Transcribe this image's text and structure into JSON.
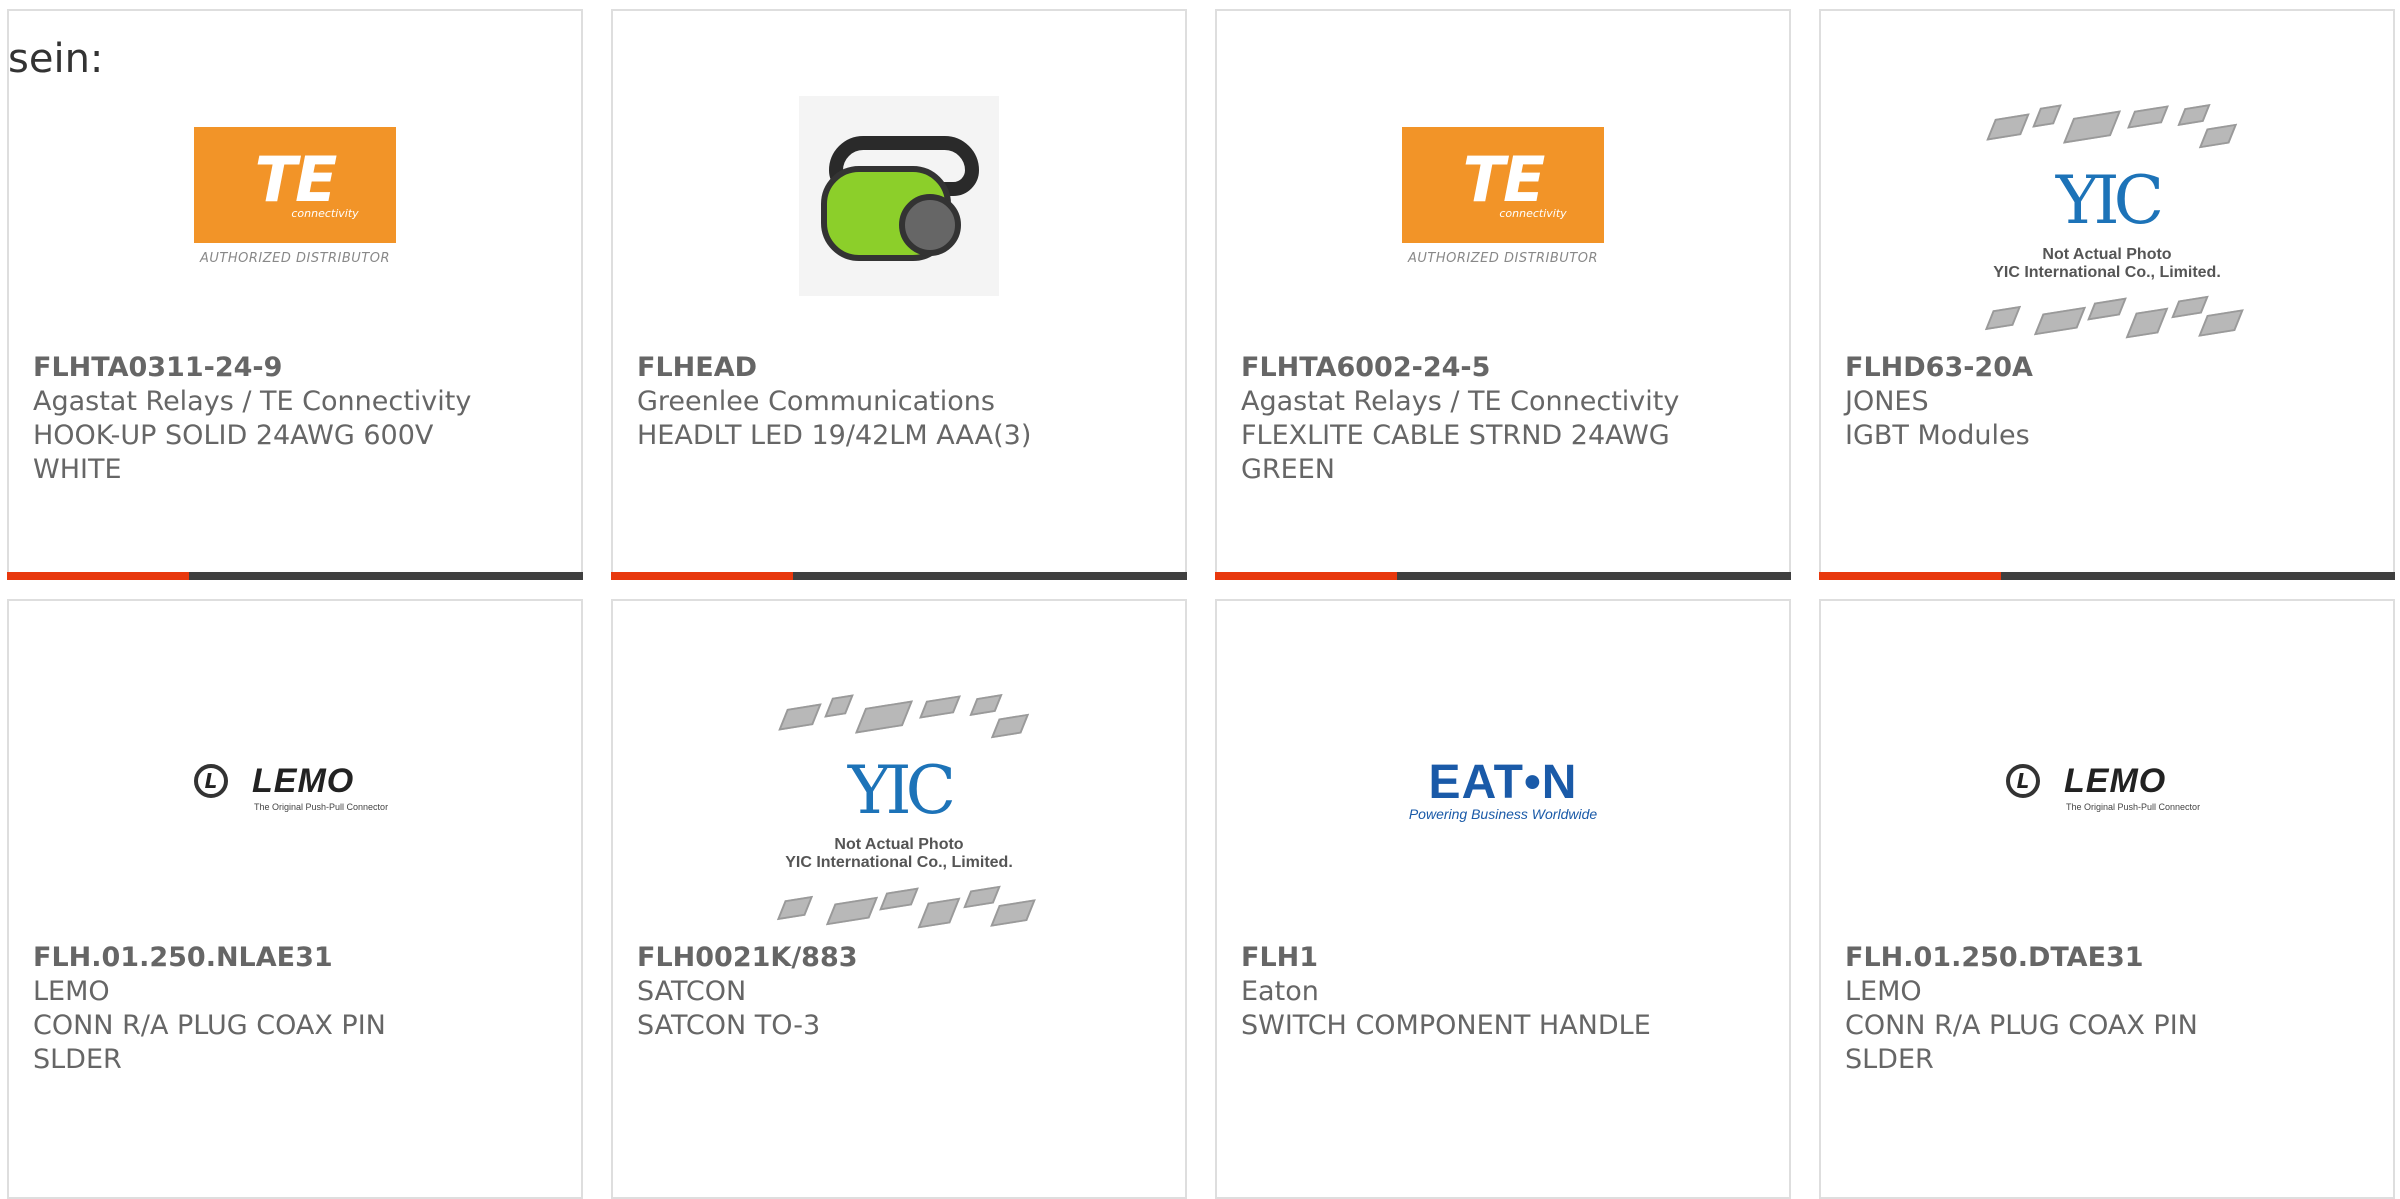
{
  "intro_text": "sein:",
  "accent_color": "#e8380d",
  "bar_color": "#3f3f3f",
  "products": [
    {
      "part_number": "FLHTA0311-24-9",
      "manufacturer": "Agastat Relays / TE Connectivity",
      "desc_line1": "HOOK-UP SOLID 24AWG 600V",
      "desc_line2": "WHITE",
      "image": "te-connectivity-logo"
    },
    {
      "part_number": "FLHEAD",
      "manufacturer": "Greenlee Communications",
      "desc_line1": "HEADLT LED 19/42LM AAA(3)",
      "desc_line2": "",
      "image": "headlamp-photo"
    },
    {
      "part_number": "FLHTA6002-24-5",
      "manufacturer": "Agastat Relays / TE Connectivity",
      "desc_line1": "FLEXLITE CABLE STRND 24AWG",
      "desc_line2": "GREEN",
      "image": "te-connectivity-logo"
    },
    {
      "part_number": "FLHD63-20A",
      "manufacturer": "JONES",
      "desc_line1": "IGBT Modules",
      "desc_line2": "",
      "image": "yic-placeholder"
    },
    {
      "part_number": "FLH.01.250.NLAE31",
      "manufacturer": "LEMO",
      "desc_line1": "CONN R/A PLUG COAX PIN",
      "desc_line2": "SLDER",
      "image": "lemo-logo"
    },
    {
      "part_number": "FLH0021K/883",
      "manufacturer": "SATCON",
      "desc_line1": "SATCON TO-3",
      "desc_line2": "",
      "image": "yic-placeholder"
    },
    {
      "part_number": "FLH1",
      "manufacturer": "Eaton",
      "desc_line1": "SWITCH COMPONENT HANDLE",
      "desc_line2": "",
      "image": "eaton-logo"
    },
    {
      "part_number": "FLH.01.250.DTAE31",
      "manufacturer": "LEMO",
      "desc_line1": "CONN R/A PLUG COAX PIN",
      "desc_line2": "SLDER",
      "image": "lemo-logo"
    }
  ],
  "logos": {
    "te_mark": "TE",
    "te_sub": "connectivity",
    "te_dist": "AUTHORIZED DISTRIBUTOR",
    "yic_mark": "YIC",
    "yic_line1": "Not Actual Photo",
    "yic_line2": "YIC International Co., Limited.",
    "lemo_mark": "L",
    "lemo_word": "LEMO",
    "lemo_tag": "The Original Push-Pull Connector",
    "eaton_word": "EAT•N",
    "eaton_tag": "Powering Business Worldwide"
  }
}
